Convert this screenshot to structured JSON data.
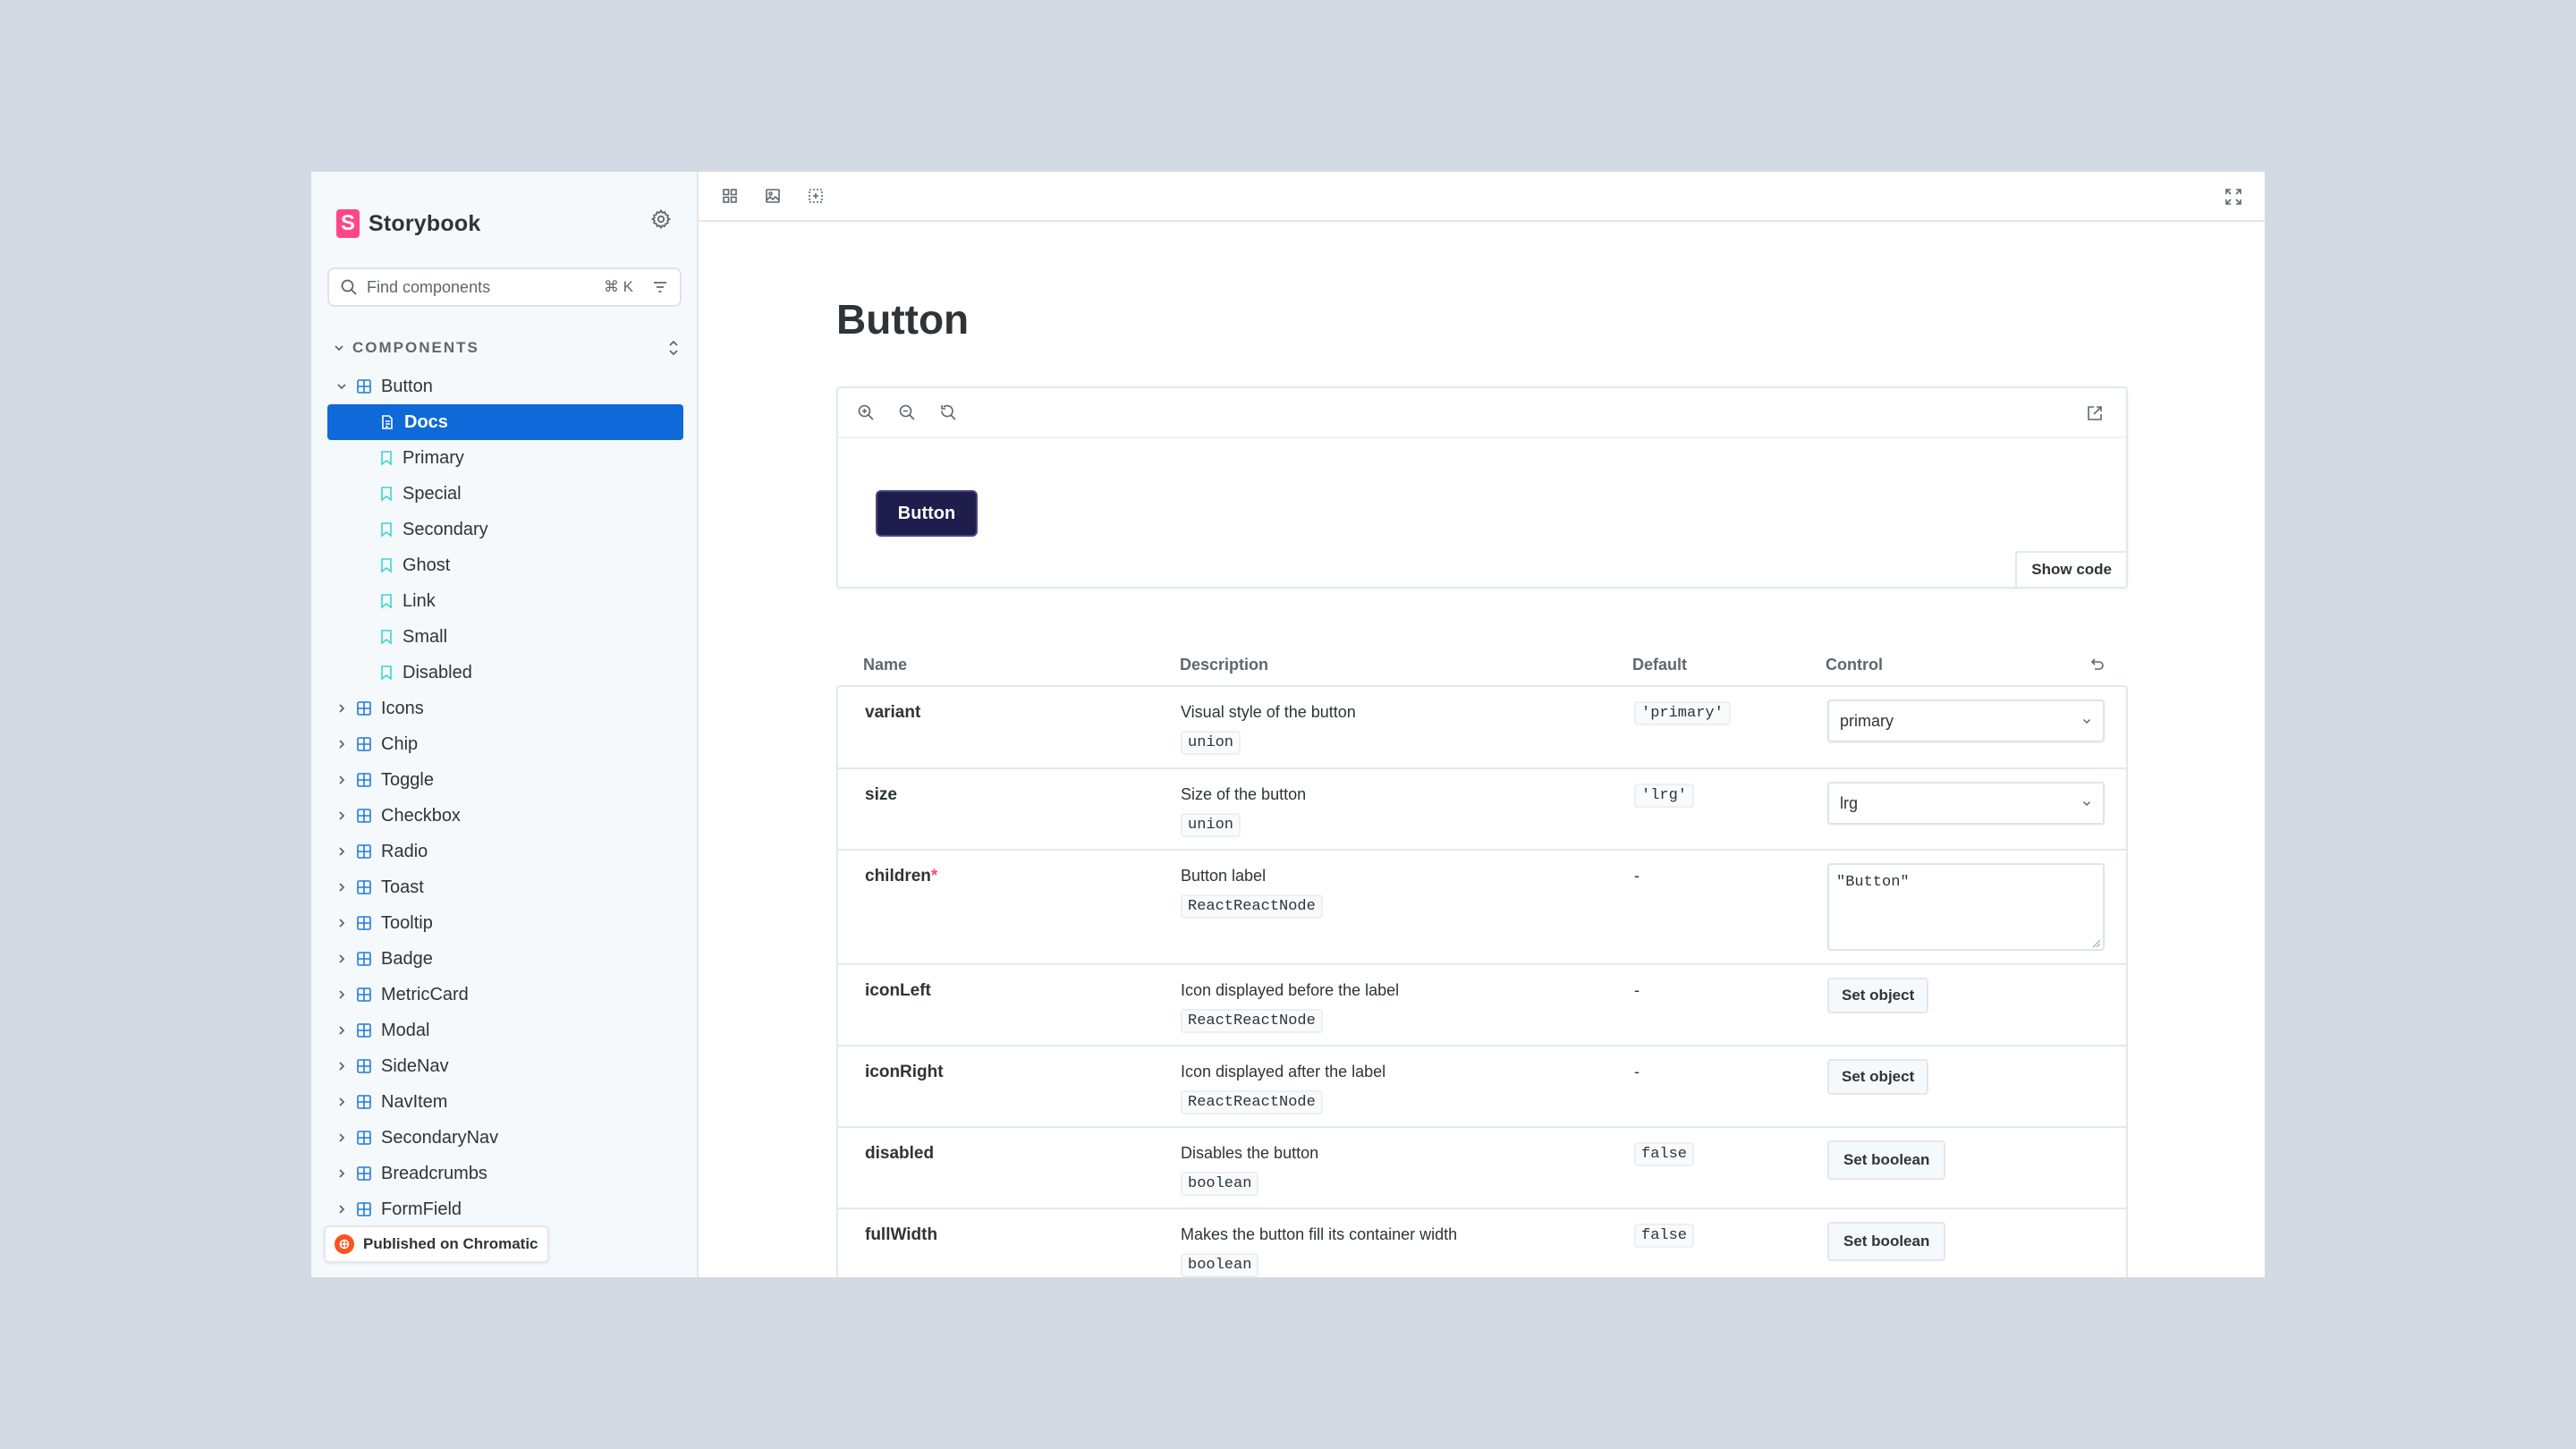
{
  "sidebar": {
    "brand": {
      "logo_letter": "S",
      "name": "Storybook"
    },
    "search": {
      "placeholder": "Find components",
      "shortcut": "⌘ K"
    },
    "section_label": "COMPONENTS",
    "button_group": {
      "label": "Button",
      "children": [
        {
          "label": "Docs",
          "kind": "doc",
          "selected": true
        },
        {
          "label": "Primary",
          "kind": "story"
        },
        {
          "label": "Special",
          "kind": "story"
        },
        {
          "label": "Secondary",
          "kind": "story"
        },
        {
          "label": "Ghost",
          "kind": "story"
        },
        {
          "label": "Link",
          "kind": "story"
        },
        {
          "label": "Small",
          "kind": "story"
        },
        {
          "label": "Disabled",
          "kind": "story"
        }
      ]
    },
    "components": [
      "Icons",
      "Chip",
      "Toggle",
      "Checkbox",
      "Radio",
      "Toast",
      "Tooltip",
      "Badge",
      "MetricCard",
      "Modal",
      "SideNav",
      "NavItem",
      "SecondaryNav",
      "Breadcrumbs",
      "FormField"
    ],
    "published_label": "Published on Chromatic"
  },
  "toolbar": {
    "icons": [
      "grid-icon",
      "image-icon",
      "outline-icon"
    ],
    "fullscreen_icon": "expand-icon"
  },
  "doc": {
    "title": "Button",
    "preview": {
      "zoom_icons": [
        "zoom-in-icon",
        "zoom-out-icon",
        "zoom-reset-icon"
      ],
      "demo_button_label": "Button",
      "show_code_label": "Show code"
    },
    "args_table": {
      "headers": {
        "name": "Name",
        "description": "Description",
        "default": "Default",
        "control": "Control"
      },
      "rows": [
        {
          "name": "variant",
          "required": false,
          "description": "Visual style of the button",
          "type": "union",
          "default": "'primary'",
          "control": {
            "kind": "select",
            "value": "primary"
          }
        },
        {
          "name": "size",
          "required": false,
          "description": "Size of the button",
          "type": "union",
          "default": "'lrg'",
          "control": {
            "kind": "select",
            "value": "lrg"
          }
        },
        {
          "name": "children",
          "required": true,
          "required_mark": "*",
          "description": "Button label",
          "type": "ReactReactNode",
          "default": "-",
          "control": {
            "kind": "textarea",
            "value": "\"Button\""
          }
        },
        {
          "name": "iconLeft",
          "required": false,
          "description": "Icon displayed before the label",
          "type": "ReactReactNode",
          "default": "-",
          "control": {
            "kind": "button",
            "value": "Set object"
          }
        },
        {
          "name": "iconRight",
          "required": false,
          "description": "Icon displayed after the label",
          "type": "ReactReactNode",
          "default": "-",
          "control": {
            "kind": "button",
            "value": "Set object"
          }
        },
        {
          "name": "disabled",
          "required": false,
          "description": "Disables the button",
          "type": "boolean",
          "default": "false",
          "control": {
            "kind": "button",
            "value": "Set boolean"
          }
        },
        {
          "name": "fullWidth",
          "required": false,
          "description": "Makes the button fill its container width",
          "type": "boolean",
          "default": "false",
          "control": {
            "kind": "button",
            "value": "Set boolean"
          }
        }
      ]
    }
  },
  "colors": {
    "accent": "#0f69d8",
    "brand": "#ff4785",
    "demo_button": "#1f1d4b",
    "background": "#d4dae4"
  }
}
